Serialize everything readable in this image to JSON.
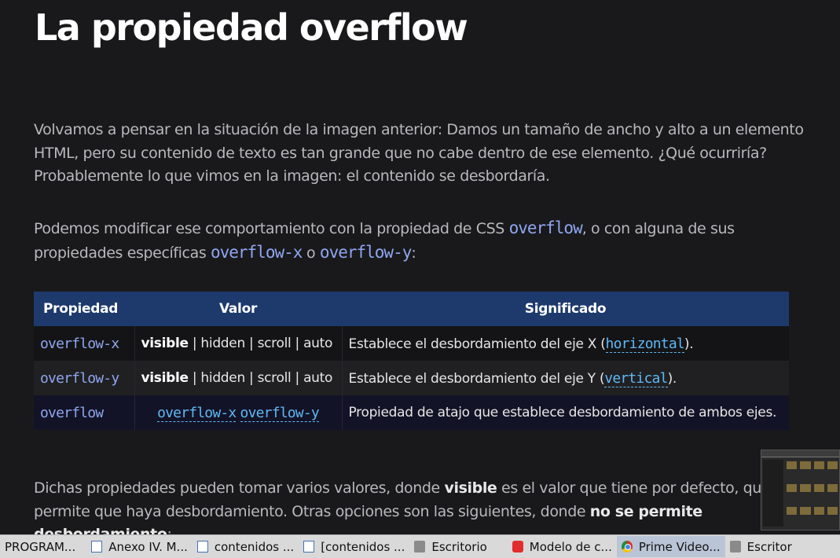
{
  "heading": "La propiedad overflow",
  "paragraph1": "Volvamos a pensar en la situación de la imagen anterior: Damos un tamaño de ancho y alto a un elemento HTML, pero su contenido de texto es tan grande que no cabe dentro de ese elemento. ¿Qué ocurriría? Probablemente lo que vimos en la imagen: el contenido se desbordaría.",
  "paragraph2": {
    "text_before": "Podemos modificar ese comportamiento con la propiedad de CSS ",
    "code_overflow": "overflow",
    "text_middle": ", o con alguna de sus propiedades específicas ",
    "code_x": "overflow-x",
    "text_or": " o ",
    "code_y": "overflow-y",
    "text_end": ":"
  },
  "table": {
    "headers": [
      "Propiedad",
      "Valor",
      "Significado"
    ],
    "rows": [
      {
        "property": "overflow-x",
        "value_bold": "visible",
        "value_rest": " | hidden | scroll | auto",
        "meaning_before": "Establece el desbordamiento del eje X (",
        "meaning_link": "horizontal",
        "meaning_after": ")."
      },
      {
        "property": "overflow-y",
        "value_bold": "visible",
        "value_rest": " | hidden | scroll | auto",
        "meaning_before": "Establece el desbordamiento del eje Y (",
        "meaning_link": "vertical",
        "meaning_after": ")."
      },
      {
        "property": "overflow",
        "value_link1": "overflow-x",
        "value_link2": "overflow-y",
        "meaning": "Propiedad de atajo que establece desbordamiento de ambos ejes."
      }
    ]
  },
  "paragraph3": {
    "text1": "Dichas propiedades pueden tomar varios valores, donde ",
    "bold1": "visible",
    "text2": " es el valor que tiene por defecto, que permite que haya desbordamiento. Otras opciones son las siguientes, donde ",
    "bold2": "no se permite desbordamiento",
    "text3": ":"
  },
  "taskbar": [
    {
      "label": "PROGRAM...",
      "icon": "none"
    },
    {
      "label": "Anexo IV. M...",
      "icon": "document-icon"
    },
    {
      "label": "contenidos ...",
      "icon": "document-icon"
    },
    {
      "label": "[contenidos ...",
      "icon": "document-icon"
    },
    {
      "label": "Escritorio",
      "icon": "folder-icon"
    },
    {
      "label": "Modelo de c...",
      "icon": "vivaldi-icon"
    },
    {
      "label": "Prime Video...",
      "icon": "chrome-icon",
      "active": true
    },
    {
      "label": "Escritor",
      "icon": "folder-icon"
    }
  ],
  "colors": {
    "background": "#19191b",
    "table_header": "#1e3a6d",
    "code": "#8fa6f0",
    "link": "#5fb8f5"
  }
}
